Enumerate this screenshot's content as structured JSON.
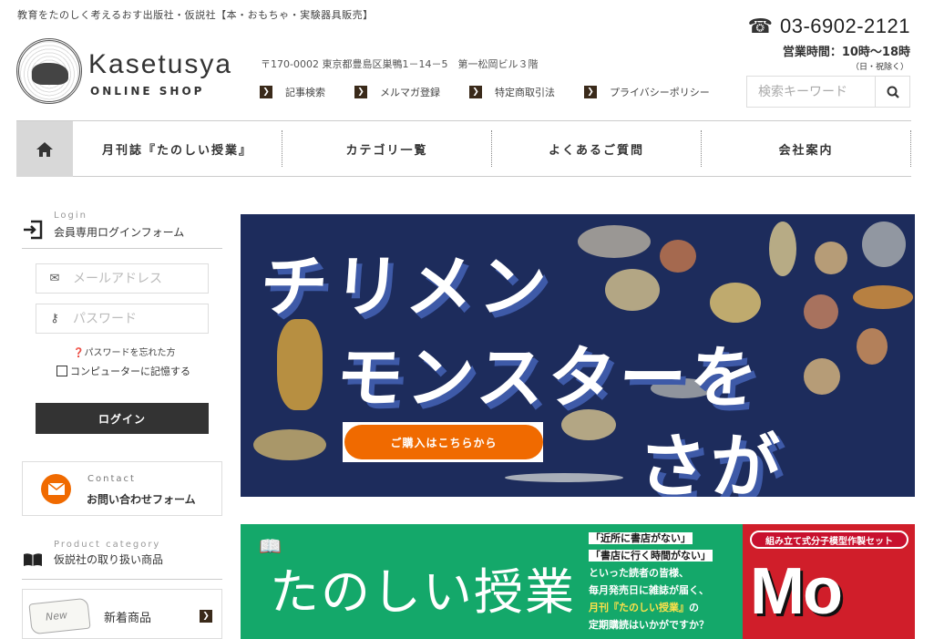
{
  "header": {
    "tagline": "教育をたのしく考えるおす出版社・仮説社【本・おもちゃ・実験器具販売】",
    "logo_title": "Kasetusya",
    "logo_sub": "ONLINE SHOP",
    "address": "〒170-0002 東京都豊島区巣鴨1－14－5　第一松岡ビル３階",
    "links": [
      "記事検索",
      "メルマガ登録",
      "特定商取引法",
      "プライバシーポリシー"
    ],
    "phone": "03-6902-2121",
    "hours": "営業時間：10時〜18時",
    "holiday": "（日・祝除く）",
    "search_placeholder": "検索キーワード"
  },
  "nav": {
    "items": [
      "月刊誌『たのしい授業』",
      "カテゴリ一覧",
      "よくあるご質問",
      "会社案内"
    ]
  },
  "sidebar": {
    "login": {
      "en": "Login",
      "ja": "会員専用ログインフォーム",
      "email_placeholder": "メールアドレス",
      "password_placeholder": "パスワード",
      "forgot": "パスワードを忘れた方",
      "remember": "コンピューターに記憶する",
      "button": "ログイン"
    },
    "contact": {
      "en": "Contact",
      "ja": "お問い合わせフォーム"
    },
    "category": {
      "en": "Product category",
      "ja": "仮説社の取り扱い商品",
      "new_scroll": "New",
      "new_label": "新着商品"
    }
  },
  "banner1": {
    "line1": "チリメン",
    "line2": "モンスターを",
    "line3": "さがせ！",
    "buy_button": "ご購入はこちらから"
  },
  "banner2": {
    "title": "たのしい授業",
    "q1": "「近所に書店がない」",
    "q2": "「書店に行く時間がない」",
    "t1": "といった読者の皆様、",
    "t2": "毎月発売日に雑誌が届く、",
    "t3a": "月刊『たのしい授業』",
    "t3b": "の",
    "t4": "定期購読はいかがですか？"
  },
  "banner3": {
    "head": "組み立て式分子模型作製セット",
    "title": "Mo"
  },
  "colors": {
    "accent_orange": "#f06a00",
    "nav_home_bg": "#d8d8d8",
    "banner1_bg": "#1d2c5c",
    "banner2_bg": "#14a86a",
    "banner3_bg": "#d01e2a"
  }
}
